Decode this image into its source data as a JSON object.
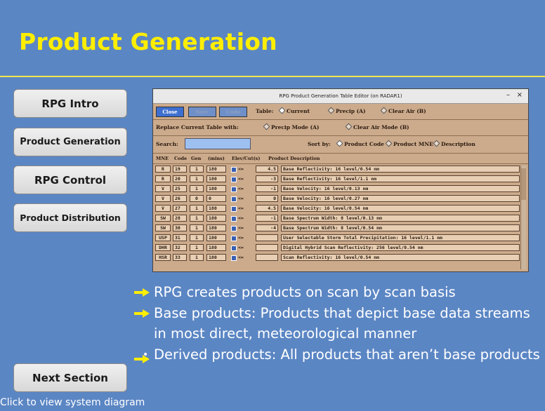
{
  "title": "Product Generation",
  "nav": {
    "intro": "RPG Intro",
    "product_generation": "Product Generation",
    "control": "RPG Control",
    "distribution": "Product Distribution",
    "next": "Next Section"
  },
  "footer": "Click to view system diagram",
  "editor": {
    "title": "RPG Product Generation Table Editor (on RADAR1)",
    "buttons": {
      "close": "Close",
      "save": "Save",
      "undo": "Undo"
    },
    "table_label": "Table:",
    "table_options": [
      "Current",
      "Precip (A)",
      "Clear Air (B)"
    ],
    "replace_label": "Replace Current Table with:",
    "replace_options": [
      "Precip Mode (A)",
      "Clear Air Mode (B)"
    ],
    "search_label": "Search:",
    "search_value": "",
    "sort_label": "Sort by:",
    "sort_options": [
      "Product Code",
      "Product MNE",
      "Description"
    ],
    "columns": [
      "MNE",
      "Code",
      "Gen",
      "(mins)",
      "Elev/Cut(s)",
      "Product Description"
    ],
    "rows": [
      {
        "mne": "R",
        "code": "19",
        "gen": "1",
        "mins": "180",
        "op": "<=",
        "elev": "4.5",
        "desc": "Base Reflectivity: 16 level/0.54 nm"
      },
      {
        "mne": "R",
        "code": "20",
        "gen": "1",
        "mins": "180",
        "op": "<=",
        "elev": "-3",
        "desc": "Base Reflectivity: 16 level/1.1 nm"
      },
      {
        "mne": "V",
        "code": "25",
        "gen": "1",
        "mins": "180",
        "op": "<=",
        "elev": "-1",
        "desc": "Base Velocity: 16 level/0.13 nm"
      },
      {
        "mne": "V",
        "code": "26",
        "gen": "0",
        "mins": "0",
        "op": "<=",
        "elev": "0",
        "desc": "Base Velocity: 16 level/0.27 nm"
      },
      {
        "mne": "V",
        "code": "27",
        "gen": "1",
        "mins": "180",
        "op": "<=",
        "elev": "4.5",
        "desc": "Base Velocity: 16 level/0.54 nm"
      },
      {
        "mne": "SW",
        "code": "28",
        "gen": "1",
        "mins": "180",
        "op": "<=",
        "elev": "-1",
        "desc": "Base Spectrum Width: 8 level/0.13 nm"
      },
      {
        "mne": "SW",
        "code": "30",
        "gen": "1",
        "mins": "180",
        "op": "<=",
        "elev": "-4",
        "desc": "Base Spectrum Width: 8 level/0.54 nm"
      },
      {
        "mne": "USP",
        "code": "31",
        "gen": "1",
        "mins": "180",
        "op": "<=",
        "elev": "",
        "desc": "User Selectable Storm Total Precipitation: 16 level/1.1 nm"
      },
      {
        "mne": "DHR",
        "code": "32",
        "gen": "1",
        "mins": "180",
        "op": "<=",
        "elev": "",
        "desc": "Digital Hybrid Scan Reflectivity: 256 level/0.54 nm"
      },
      {
        "mne": "HSR",
        "code": "33",
        "gen": "1",
        "mins": "180",
        "op": "<=",
        "elev": "",
        "desc": "Scan Reflectivity: 16 level/0.54 nm"
      }
    ]
  },
  "bullets": [
    "RPG creates products on scan by scan basis",
    "Base products: Products that depict base data streams in most direct, meteorological manner",
    "Derived products: All products that aren’t base products"
  ],
  "colors": {
    "background": "#5b86c4",
    "title": "#ffee00",
    "rule": "#f3e74c",
    "arrow": "#ffee00"
  },
  "icons": [
    "arrow-right-icon",
    "minimize-icon",
    "close-icon"
  ]
}
